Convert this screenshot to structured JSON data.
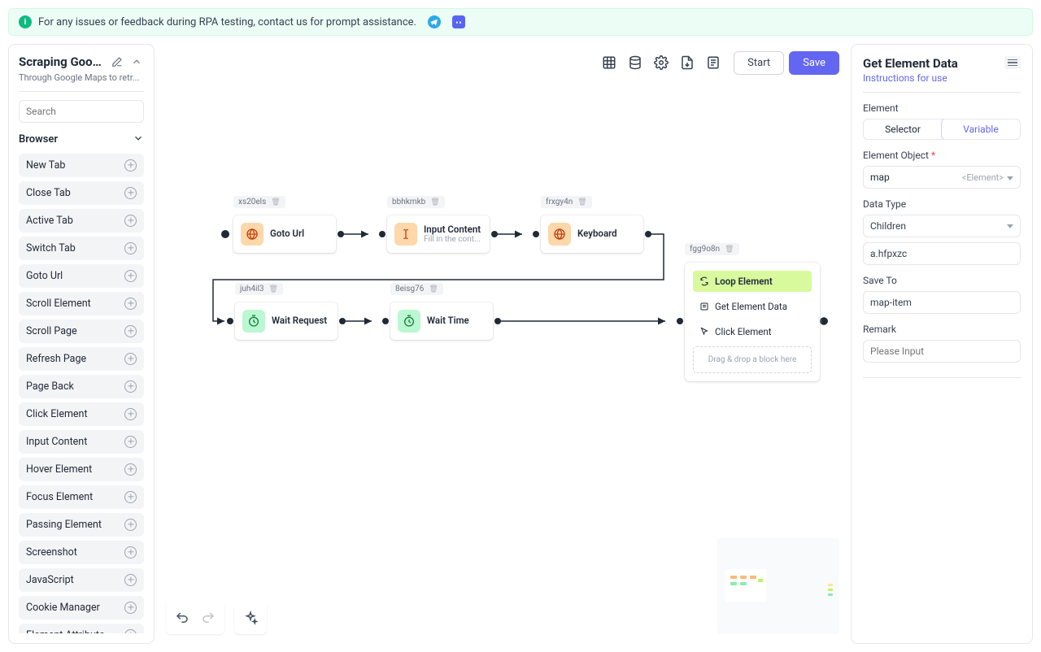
{
  "banner": {
    "text": "For any issues or feedback during RPA testing, contact us for prompt assistance."
  },
  "project": {
    "title": "Scraping Google...",
    "subtitle": "Through Google Maps to retr...",
    "search_placeholder": "Search"
  },
  "sidebar": {
    "category": "Browser",
    "items": [
      "New Tab",
      "Close Tab",
      "Active Tab",
      "Switch Tab",
      "Goto Url",
      "Scroll Element",
      "Scroll Page",
      "Refresh Page",
      "Page Back",
      "Click Element",
      "Input Content",
      "Hover Element",
      "Focus Element",
      "Passing Element",
      "Screenshot",
      "JavaScript",
      "Cookie Manager",
      "Element Attribute"
    ]
  },
  "toolbar": {
    "start": "Start",
    "save": "Save"
  },
  "nodes": {
    "n1": {
      "tag": "xs20els",
      "label": "Goto Url"
    },
    "n2": {
      "tag": "bbhkmkb",
      "label": "Input Content",
      "sub": "Fill in the cont..."
    },
    "n3": {
      "tag": "frxgy4n",
      "label": "Keyboard"
    },
    "n4": {
      "tag": "juh4il3",
      "label": "Wait Request"
    },
    "n5": {
      "tag": "8eisg76",
      "label": "Wait Time"
    },
    "loop": {
      "tag": "fgg9o8n",
      "head": "Loop Element",
      "rows": [
        "Get Element Data",
        "Click Element"
      ],
      "drop": "Drag & drop a block here"
    }
  },
  "right": {
    "title": "Get Element Data",
    "link": "Instructions for use",
    "sec_element": "Element",
    "seg_selector": "Selector",
    "seg_variable": "Variable",
    "obj_label": "Element Object",
    "obj_value": "map",
    "obj_type": "<Element>",
    "data_type_label": "Data Type",
    "data_type_value": "Children",
    "selector_value": "a.hfpxzc",
    "save_to_label": "Save To",
    "save_to_value": "map-item",
    "remark_label": "Remark",
    "remark_placeholder": "Please Input"
  }
}
